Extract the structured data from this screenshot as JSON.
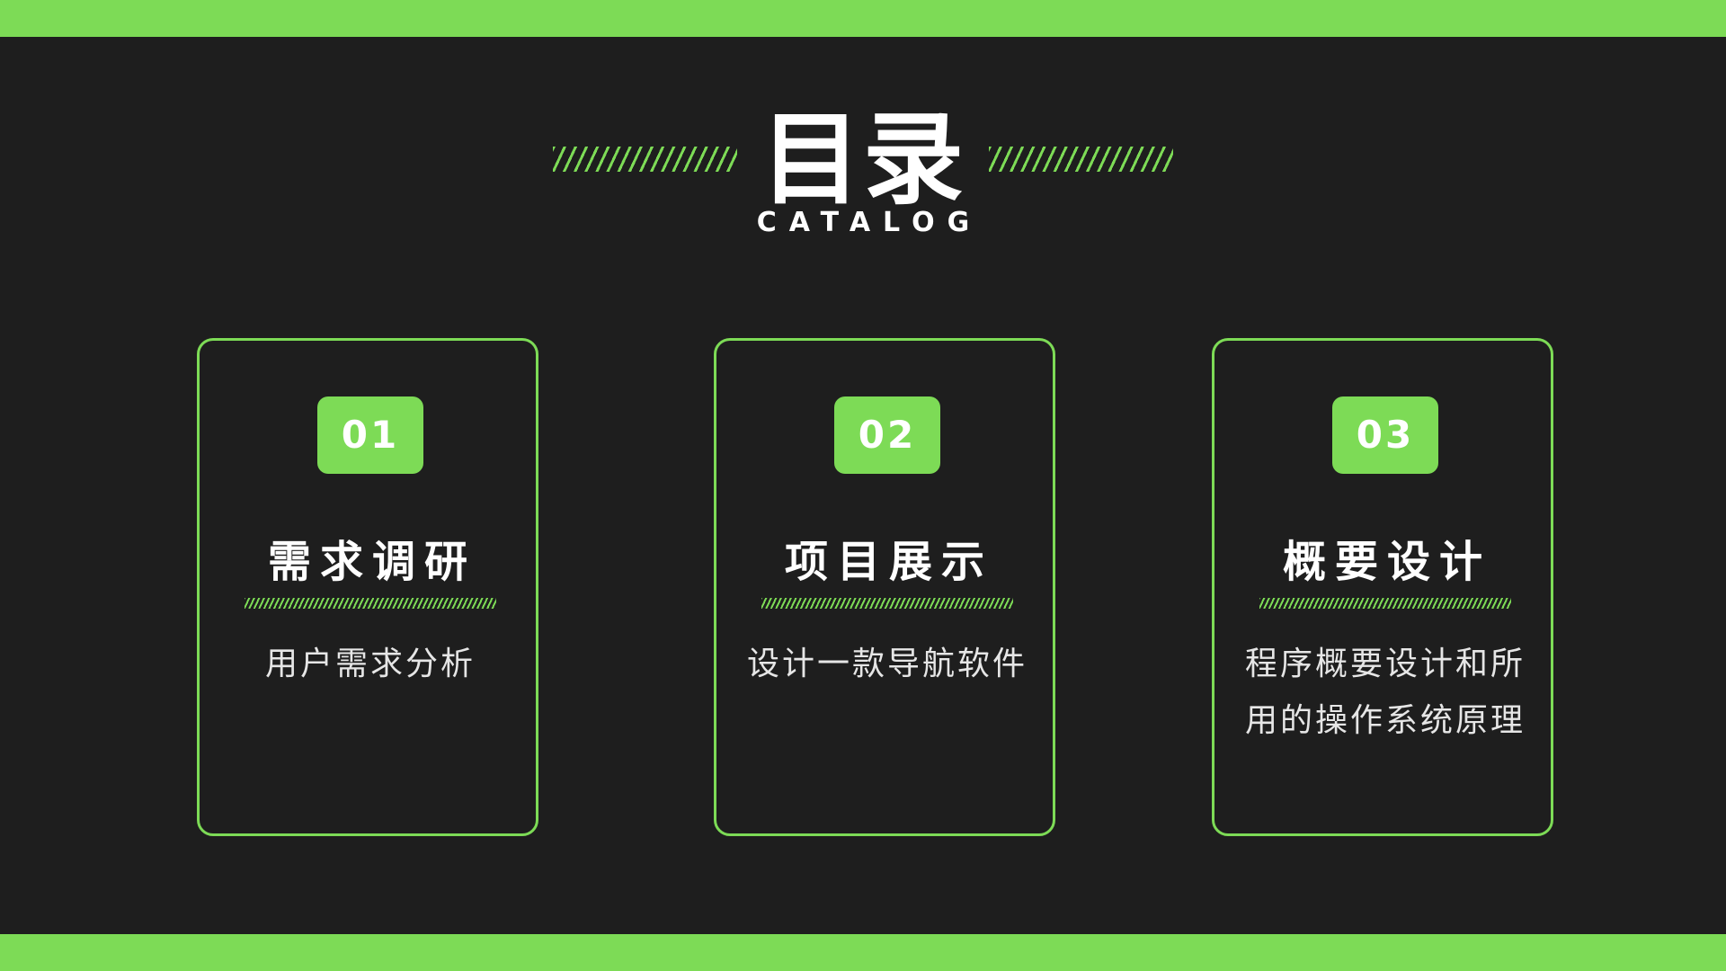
{
  "header": {
    "title": "目录",
    "subtitle": "CATALOG"
  },
  "colors": {
    "accent": "#7ddb56",
    "background": "#1e1e1e",
    "text": "#ffffff"
  },
  "cards": [
    {
      "number": "01",
      "title": "需求调研",
      "description": "用户需求分析"
    },
    {
      "number": "02",
      "title": "项目展示",
      "description": "设计一款导航软件"
    },
    {
      "number": "03",
      "title": "概要设计",
      "description": "程序概要设计和所用的操作系统原理"
    }
  ]
}
